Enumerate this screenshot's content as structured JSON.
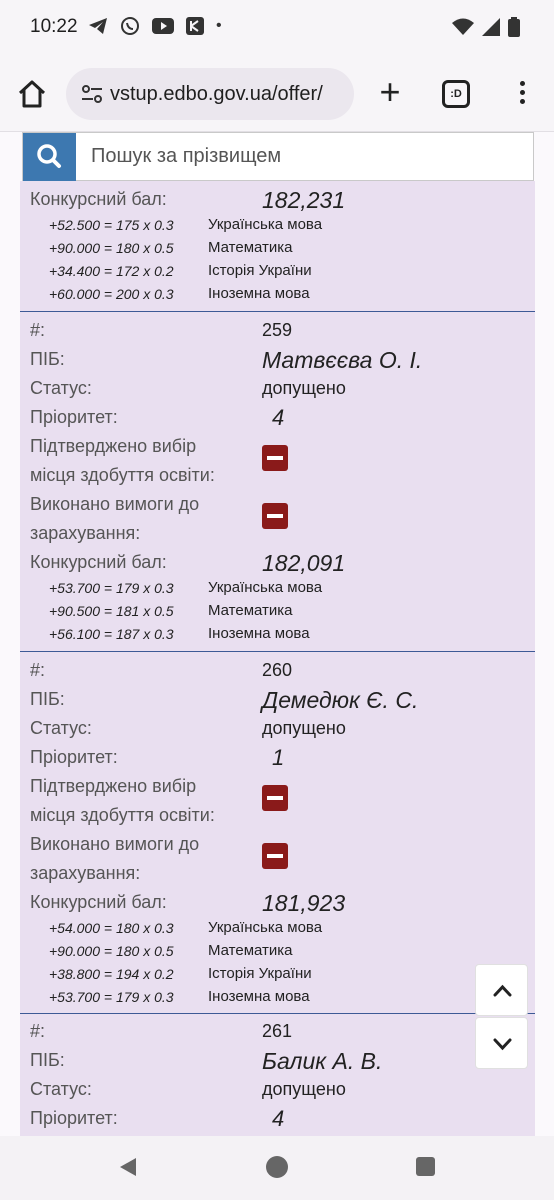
{
  "status_bar": {
    "time": "10:22",
    "icons": [
      "telegram-icon",
      "viber-icon",
      "youtube-icon",
      "kyivstar-icon",
      "dot-icon",
      "wifi-icon",
      "signal-icon",
      "battery-icon"
    ],
    "dot": "•"
  },
  "browser": {
    "url": "vstup.edbo.gov.ua/offer/",
    "tabs_label": ":D",
    "plus": "+"
  },
  "search": {
    "placeholder": "Пошук за прізвищем"
  },
  "labels": {
    "number": "#:",
    "name": "ПІБ:",
    "status": "Статус:",
    "priority": "Пріоритет:",
    "confirmed_line1": "Підтверджено вибір",
    "confirmed_line2": "місця здобуття освіти:",
    "requirements_line1": "Виконано вимоги до",
    "requirements_line2": "зарахування:",
    "score": "Конкурсний бал:"
  },
  "partial_top": {
    "score": "182,231",
    "components": [
      {
        "formula": "+52.500 = 175 x 0.3",
        "subject": "Українська мова"
      },
      {
        "formula": "+90.000 = 180 x 0.5",
        "subject": "Математика"
      },
      {
        "formula": "+34.400 = 172 x 0.2",
        "subject": "Історія України"
      },
      {
        "formula": "+60.000 = 200 x 0.3",
        "subject": "Іноземна мова"
      }
    ]
  },
  "applicants": [
    {
      "number": "259",
      "name": "Матвєєва О. І.",
      "status": "допущено",
      "priority": "4",
      "score": "182,091",
      "components": [
        {
          "formula": "+53.700 = 179 x 0.3",
          "subject": "Українська мова"
        },
        {
          "formula": "+90.500 = 181 x 0.5",
          "subject": "Математика"
        },
        {
          "formula": "+56.100 = 187 x 0.3",
          "subject": "Іноземна мова"
        }
      ]
    },
    {
      "number": "260",
      "name": "Демедюк Є. С.",
      "status": "допущено",
      "priority": "1",
      "score": "181,923",
      "components": [
        {
          "formula": "+54.000 = 180 x 0.3",
          "subject": "Українська мова"
        },
        {
          "formula": "+90.000 = 180 x 0.5",
          "subject": "Математика"
        },
        {
          "formula": "+38.800 = 194 x 0.2",
          "subject": "Історія України"
        },
        {
          "formula": "+53.700 = 179 x 0.3",
          "subject": "Іноземна мова"
        }
      ]
    },
    {
      "number": "261",
      "name": "Балик А. В.",
      "status": "допущено",
      "priority": "4"
    }
  ]
}
